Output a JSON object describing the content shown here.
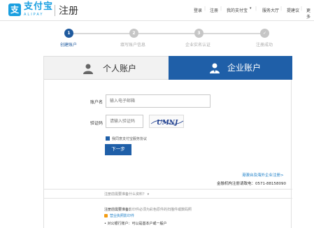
{
  "header": {
    "logo_char": "支",
    "logo_name": "支付宝",
    "logo_sub": "ALIPAY",
    "page_title": "注册",
    "nav": [
      "登录",
      "注册",
      "我的支付宝",
      "服务大厅",
      "提建议",
      "更多"
    ]
  },
  "steps": [
    {
      "num": "1",
      "label": "创建账户"
    },
    {
      "num": "2",
      "label": "填写账户信息"
    },
    {
      "num": "3",
      "label": "企业实名认证"
    },
    {
      "num": "✓",
      "label": "注册成功"
    }
  ],
  "tabs": {
    "personal": "个人账户",
    "enterprise": "企业账户"
  },
  "form": {
    "account_label": "账户名",
    "account_placeholder": "输入电子邮箱",
    "captcha_label": "验证码",
    "captcha_placeholder": "请输入验证码",
    "captcha_image_text": "UMNJ",
    "agree_text": "我同意支付宝服务协议",
    "next_button": "下一步"
  },
  "bottom": {
    "hk_link": "港澳台及海外企业注册>",
    "finance_text": "金融机构注册请致电：0571-88158090",
    "materials_toggle": "注册前需要准备什么资料？ ▾",
    "prepare_title": "注册前需要准备：",
    "prepare_desc": "影印件必须为彩色原件的扫描件或数码照",
    "license_link": "营业执照影印件",
    "bank_text": "• 对公银行账户：可以是基本户或一般户"
  }
}
